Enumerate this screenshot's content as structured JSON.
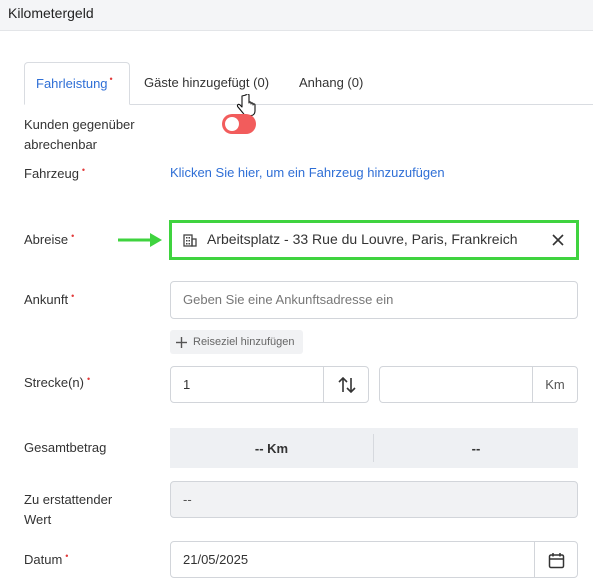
{
  "header": {
    "title": "Kilometergeld"
  },
  "tabs": [
    {
      "label": "Fahrleistung",
      "required": "•"
    },
    {
      "label": "Gäste hinzugefügt (0)"
    },
    {
      "label": "Anhang (0)"
    }
  ],
  "fields": {
    "billable": {
      "label_line1": "Kunden gegenüber",
      "label_line2": "abrechenbar",
      "value": false
    },
    "vehicle": {
      "label": "Fahrzeug",
      "required": "•",
      "link": "Klicken Sie hier, um ein Fahrzeug hinzuzufügen"
    },
    "departure": {
      "label": "Abreise",
      "required": "•",
      "value": "Arbeitsplatz - 33 Rue du Louvre, Paris, Frankreich"
    },
    "arrival": {
      "label": "Ankunft",
      "required": "•",
      "placeholder": "Geben Sie eine Ankunftsadresse ein"
    },
    "add_destination": "Reiseziel hinzufügen",
    "distance": {
      "label": "Strecke(n)",
      "required": "•",
      "value": "1",
      "unit": "Km"
    },
    "total": {
      "label": "Gesamtbetrag",
      "km": "-- Km",
      "amount": "--"
    },
    "refund": {
      "label_line1": "Zu erstattender",
      "label_line2": "Wert",
      "value": "--"
    },
    "date": {
      "label": "Datum",
      "required": "•",
      "value": "21/05/2025"
    }
  },
  "colors": {
    "accent": "#2f6fd6",
    "required": "#e23b3b",
    "toggle_off": "#f25c5c",
    "highlight": "#3fd33f"
  },
  "icons": [
    "building-icon",
    "close-icon",
    "swap-vertical-icon",
    "plus-icon",
    "calendar-icon",
    "arrow-right-icon",
    "hand-cursor-icon"
  ]
}
